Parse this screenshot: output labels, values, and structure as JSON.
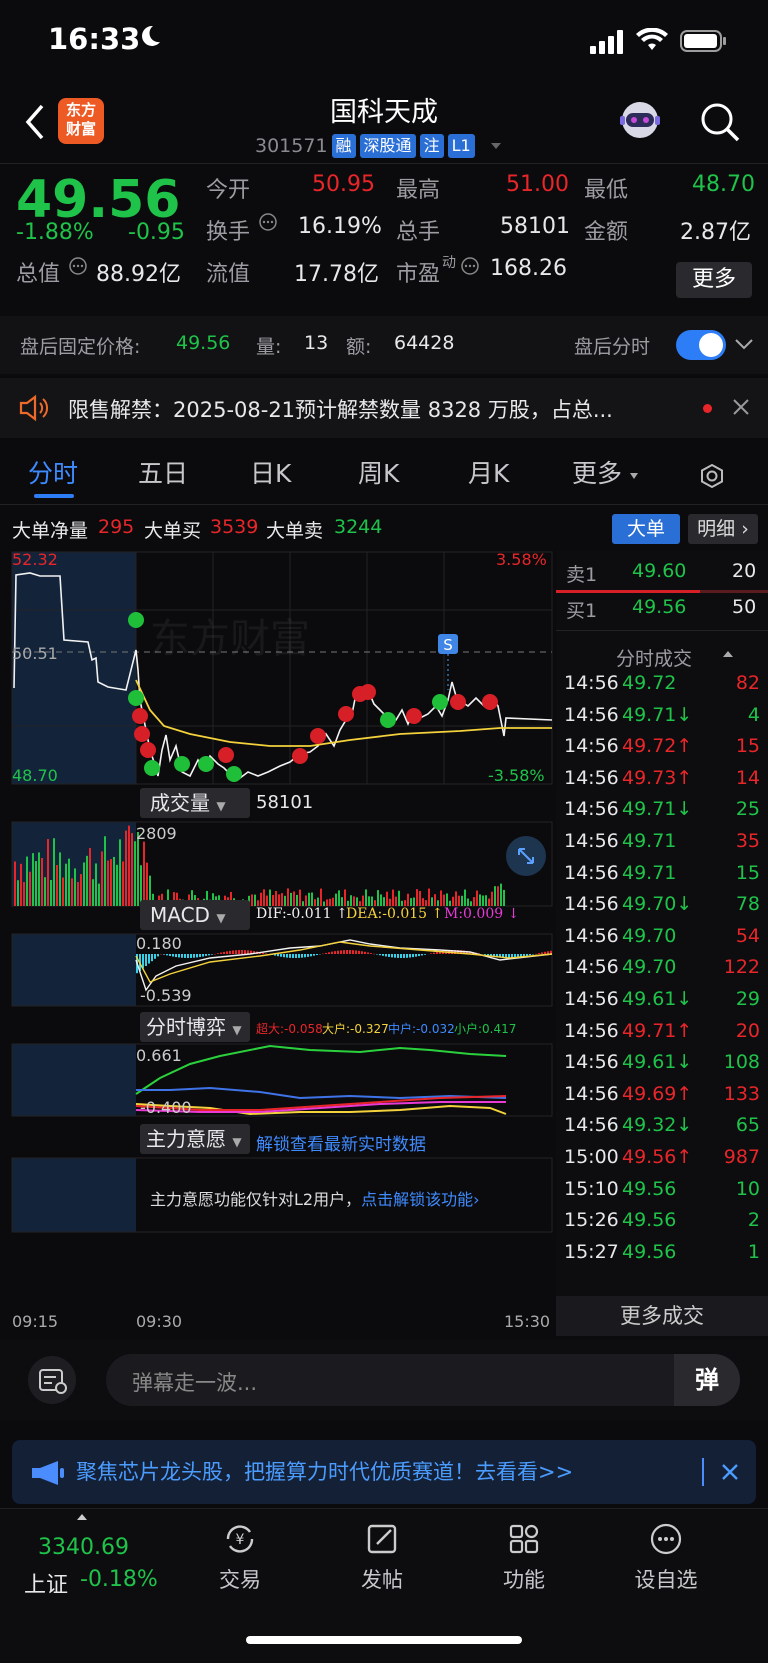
{
  "status": {
    "time": "16:33"
  },
  "header": {
    "title": "国科天成",
    "code": "301571",
    "tags": [
      "融",
      "深股通",
      "注",
      "L1"
    ],
    "logo_text": "东方财富"
  },
  "quote": {
    "price": "49.56",
    "pct": "-1.88%",
    "chg": "-0.95",
    "open_label": "今开",
    "open": "50.95",
    "high_label": "最高",
    "high": "51.00",
    "low_label": "最低",
    "low": "48.70",
    "turnover_label": "换手",
    "turnover": "16.19%",
    "vol_label": "总手",
    "vol": "58101",
    "amount_label": "金额",
    "amount": "2.87亿",
    "mcap_label": "总值",
    "mcap": "88.92亿",
    "float_label": "流值",
    "float": "17.78亿",
    "pe_label": "市盈",
    "pe_sup": "动",
    "pe": "168.26",
    "more": "更多"
  },
  "after": {
    "label": "盘后固定价格:",
    "price": "49.56",
    "vol_label": "量:",
    "vol": "13",
    "amt_label": "额:",
    "amt": "64428",
    "switch_label": "盘后分时"
  },
  "notice": {
    "text": "限售解禁：2025-08-21预计解禁数量 8328 万股，占总..."
  },
  "tabs": [
    "分时",
    "五日",
    "日K",
    "周K",
    "月K",
    "更多"
  ],
  "bigorder": {
    "net_label": "大单净量",
    "net": "295",
    "buy_label": "大单买",
    "buy": "3539",
    "sell_label": "大单卖",
    "sell": "3244",
    "btn1": "大单",
    "btn2": "明细"
  },
  "chart": {
    "y_top": "52.32",
    "y_mid": "50.51",
    "y_bottom": "48.70",
    "pct_top": "3.58%",
    "pct_bottom": "-3.58%",
    "watermark": "东方财富",
    "s_marker": "S",
    "vol_label": "成交量",
    "vol_value": "58101",
    "vol_max": "2809",
    "macd_label": "MACD",
    "dif": "DIF:-0.011 ↑",
    "dea": "DEA:-0.015 ↑",
    "m": "M:0.009 ↓",
    "macd_top": "0.180",
    "macd_bottom": "-0.539",
    "game_label": "分时博弈",
    "g1": "超大:-0.058",
    "g2": "大户:-0.327",
    "g3": "中户:-0.032",
    "g4": "小户:0.417",
    "game_top": "0.661",
    "game_bottom": "-0.400",
    "main_label": "主力意愿",
    "main_link": "解锁查看最新实时数据",
    "main_note": "主力意愿功能仅针对L2用户，",
    "main_unlock": "点击解锁该功能",
    "t1": "09:15",
    "t2": "09:30",
    "t3": "15:30"
  },
  "orderbook": {
    "sell_label": "卖1",
    "sell_price": "49.60",
    "sell_vol": "20",
    "buy_label": "买1",
    "buy_price": "49.56",
    "buy_vol": "50",
    "ticks_title": "分时成交",
    "more": "更多成交"
  },
  "ticks": [
    {
      "t": "14:56",
      "p": "49.72",
      "v": "82",
      "c": "r"
    },
    {
      "t": "14:56",
      "p": "49.71↓",
      "v": "4",
      "c": "g"
    },
    {
      "t": "14:56",
      "p": "49.72↑",
      "v": "15",
      "c": "r"
    },
    {
      "t": "14:56",
      "p": "49.73↑",
      "v": "14",
      "c": "r"
    },
    {
      "t": "14:56",
      "p": "49.71↓",
      "v": "25",
      "c": "g"
    },
    {
      "t": "14:56",
      "p": "49.71",
      "v": "35",
      "c": "r"
    },
    {
      "t": "14:56",
      "p": "49.71",
      "v": "15",
      "c": "g"
    },
    {
      "t": "14:56",
      "p": "49.70↓",
      "v": "78",
      "c": "g"
    },
    {
      "t": "14:56",
      "p": "49.70",
      "v": "54",
      "c": "r"
    },
    {
      "t": "14:56",
      "p": "49.70",
      "v": "122",
      "c": "r"
    },
    {
      "t": "14:56",
      "p": "49.61↓",
      "v": "29",
      "c": "g"
    },
    {
      "t": "14:56",
      "p": "49.71↑",
      "v": "20",
      "c": "r"
    },
    {
      "t": "14:56",
      "p": "49.61↓",
      "v": "108",
      "c": "g"
    },
    {
      "t": "14:56",
      "p": "49.69↑",
      "v": "133",
      "c": "r"
    },
    {
      "t": "14:56",
      "p": "49.32↓",
      "v": "65",
      "c": "g"
    },
    {
      "t": "15:00",
      "p": "49.56↑",
      "v": "987",
      "c": "r"
    },
    {
      "t": "15:10",
      "p": "49.56",
      "v": "10",
      "c": "g"
    },
    {
      "t": "15:26",
      "p": "49.56",
      "v": "2",
      "c": "g"
    },
    {
      "t": "15:27",
      "p": "49.56",
      "v": "1",
      "c": "g"
    }
  ],
  "danmu": {
    "placeholder": "弹幕走一波...",
    "send": "弹"
  },
  "banner": {
    "text": "聚焦芯片龙头股，把握算力时代优质赛道！去看看>>"
  },
  "bottom": {
    "index_value": "3340.69",
    "index_name": "上证",
    "index_pct": "-0.18%",
    "items": [
      "交易",
      "发帖",
      "功能",
      "设自选"
    ]
  }
}
